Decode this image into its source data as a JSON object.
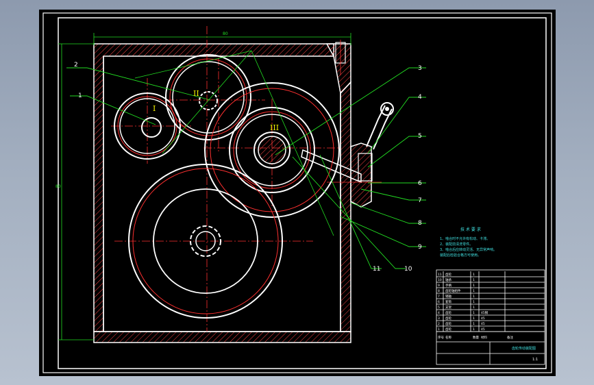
{
  "drawing": {
    "gear_labels": [
      "I",
      "II",
      "III"
    ],
    "callouts": [
      "1",
      "2",
      "3",
      "4",
      "5",
      "6",
      "7",
      "8",
      "9",
      "10",
      "11"
    ],
    "dimension_text": {
      "top": "80",
      "left": "80"
    },
    "tech_requirements": {
      "title": "技 术 要 求",
      "lines": [
        "1、啮合时不允许有松动、卡滞。",
        "2、装配前清洗零件。",
        "3、啮合后应转动灵活、无异常声响。",
        "装配后检验合格方可使用。"
      ]
    },
    "title_block": {
      "parts": [
        {
          "no": "11",
          "name": "齿轮",
          "qty": "1",
          "mat": ""
        },
        {
          "no": "10",
          "name": "轴承",
          "qty": "1",
          "mat": ""
        },
        {
          "no": "9",
          "name": "手柄",
          "qty": "1",
          "mat": ""
        },
        {
          "no": "8",
          "name": "齿轮轴组件",
          "qty": "1",
          "mat": ""
        },
        {
          "no": "7",
          "name": "销轴",
          "qty": "1",
          "mat": ""
        },
        {
          "no": "6",
          "name": "套筒",
          "qty": "1",
          "mat": ""
        },
        {
          "no": "5",
          "name": "支架",
          "qty": "1",
          "mat": ""
        },
        {
          "no": "4",
          "name": "齿轮",
          "qty": "1",
          "mat": "45钢"
        },
        {
          "no": "3",
          "name": "齿轮",
          "qty": "1",
          "mat": "45"
        },
        {
          "no": "2",
          "name": "齿轮",
          "qty": "1",
          "mat": "45"
        },
        {
          "no": "1",
          "name": "齿轮",
          "qty": "1",
          "mat": "45"
        }
      ],
      "header": {
        "no": "序号",
        "name": "名称",
        "qty": "数量",
        "mat": "材料",
        "note": "备注"
      },
      "drawing_name": "齿轮传动装配图",
      "scale": "1:1"
    }
  },
  "colors": {
    "background": "#000000",
    "outline": "#ffffff",
    "centerline": "#ff3030",
    "leader": "#22dd22",
    "hatch": "#ff4444",
    "label_yellow": "#f0f000",
    "table_text": "#40e0e0"
  }
}
